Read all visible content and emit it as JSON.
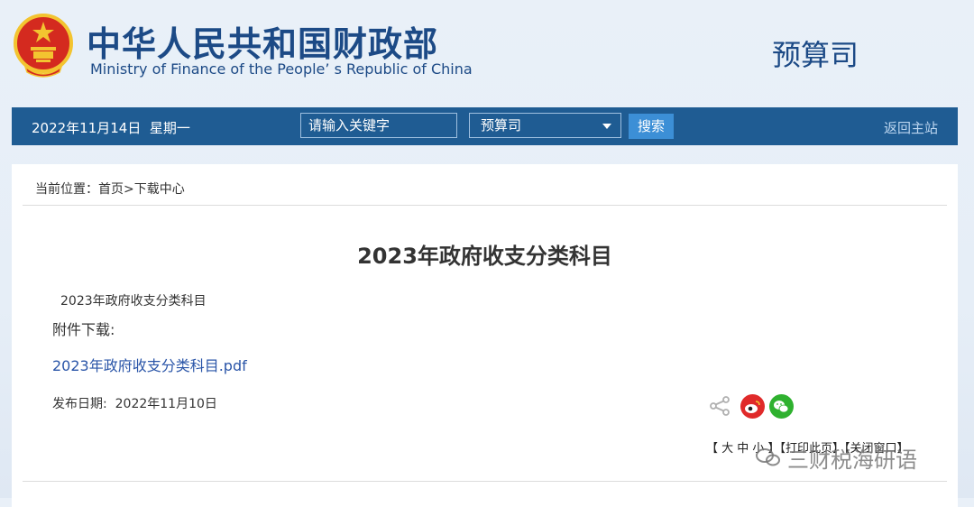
{
  "header": {
    "cn_title": "中华人民共和国财政部",
    "en_title": "Ministry of Finance of the People’ s Republic of China",
    "department": "预算司"
  },
  "navbar": {
    "date": "2022年11月14日",
    "weekday": "星期一",
    "search_placeholder": "请输入关键字",
    "select_value": "预算司",
    "search_button": "搜索",
    "home_link": "返回主站"
  },
  "breadcrumb": {
    "prefix": "当前位置：",
    "home": "首页",
    "sep": ">",
    "current": "下载中心"
  },
  "article": {
    "title": "2023年政府收支分类科目",
    "subtitle": "2023年政府收支分类科目",
    "attachment_label": "附件下载:",
    "attachment_file": "2023年政府收支分类科目.pdf",
    "publish_label": "发布日期:",
    "publish_date": "2022年11月10日"
  },
  "tools": {
    "text": "【 大 中 小 】【打印此页】【关闭窗口】"
  },
  "watermark": {
    "text": "三财税海研语"
  },
  "colors": {
    "navbar": "#1f5c93",
    "brand": "#1c4a86",
    "link": "#2a55a8",
    "weibo": "#e02a2a",
    "wechat": "#2fb12f"
  }
}
